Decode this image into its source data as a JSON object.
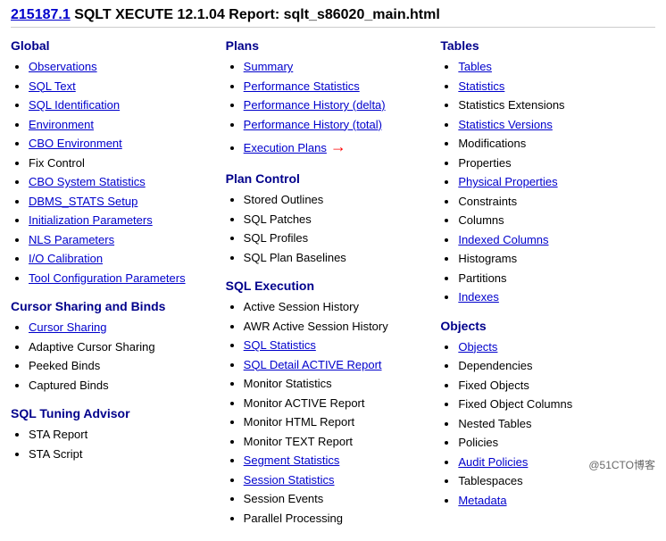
{
  "header": {
    "id": "215187.1",
    "title": "SQLT XECUTE 12.1.04  Report: sqlt_s86020_main.html"
  },
  "columns": {
    "global": {
      "title": "Global",
      "items": [
        {
          "label": "Observations",
          "link": true
        },
        {
          "label": "SQL Text",
          "link": true
        },
        {
          "label": "SQL Identification",
          "link": true
        },
        {
          "label": "Environment",
          "link": true
        },
        {
          "label": "CBO Environment",
          "link": true
        },
        {
          "label": "Fix Control",
          "link": false
        },
        {
          "label": "CBO System Statistics",
          "link": true
        },
        {
          "label": "DBMS_STATS Setup",
          "link": true
        },
        {
          "label": "Initialization Parameters",
          "link": true
        },
        {
          "label": "NLS Parameters",
          "link": true
        },
        {
          "label": "I/O Calibration",
          "link": true
        },
        {
          "label": "Tool Configuration Parameters",
          "link": true
        }
      ]
    },
    "cursor": {
      "title": "Cursor Sharing and Binds",
      "items": [
        {
          "label": "Cursor Sharing",
          "link": true
        },
        {
          "label": "Adaptive Cursor Sharing",
          "link": false
        },
        {
          "label": "Peeked Binds",
          "link": false
        },
        {
          "label": "Captured Binds",
          "link": false
        }
      ]
    },
    "sta": {
      "title": "SQL Tuning Advisor",
      "items": [
        {
          "label": "STA Report",
          "link": false
        },
        {
          "label": "STA Script",
          "link": false
        }
      ]
    },
    "plans": {
      "title": "Plans",
      "items": [
        {
          "label": "Summary",
          "link": true
        },
        {
          "label": "Performance Statistics",
          "link": true
        },
        {
          "label": "Performance History (delta)",
          "link": true
        },
        {
          "label": "Performance History (total)",
          "link": true
        },
        {
          "label": "Execution Plans",
          "link": true,
          "arrow": true
        }
      ]
    },
    "plan_control": {
      "title": "Plan Control",
      "items": [
        {
          "label": "Stored Outlines",
          "link": false
        },
        {
          "label": "SQL Patches",
          "link": false
        },
        {
          "label": "SQL Profiles",
          "link": false
        },
        {
          "label": "SQL Plan Baselines",
          "link": false
        }
      ]
    },
    "sql_execution": {
      "title": "SQL Execution",
      "items": [
        {
          "label": "Active Session History",
          "link": false
        },
        {
          "label": "AWR Active Session History",
          "link": false
        },
        {
          "label": "SQL Statistics",
          "link": true
        },
        {
          "label": "SQL Detail ACTIVE Report",
          "link": true
        },
        {
          "label": "Monitor Statistics",
          "link": false
        },
        {
          "label": "Monitor ACTIVE Report",
          "link": false
        },
        {
          "label": "Monitor HTML Report",
          "link": false
        },
        {
          "label": "Monitor TEXT Report",
          "link": false
        },
        {
          "label": "Segment Statistics",
          "link": true
        },
        {
          "label": "Session Statistics",
          "link": true
        },
        {
          "label": "Session Events",
          "link": false
        },
        {
          "label": "Parallel Processing",
          "link": false
        }
      ]
    },
    "tables": {
      "title": "Tables",
      "items": [
        {
          "label": "Tables",
          "link": true
        },
        {
          "label": "Statistics",
          "link": true
        },
        {
          "label": "Statistics Extensions",
          "link": false
        },
        {
          "label": "Statistics Versions",
          "link": true
        },
        {
          "label": "Modifications",
          "link": false
        },
        {
          "label": "Properties",
          "link": false
        },
        {
          "label": "Physical Properties",
          "link": true
        },
        {
          "label": "Constraints",
          "link": false
        },
        {
          "label": "Columns",
          "link": false
        },
        {
          "label": "Indexed Columns",
          "link": true
        },
        {
          "label": "Histograms",
          "link": false
        },
        {
          "label": "Partitions",
          "link": false
        },
        {
          "label": "Indexes",
          "link": true
        }
      ]
    },
    "objects": {
      "title": "Objects",
      "items": [
        {
          "label": "Objects",
          "link": true
        },
        {
          "label": "Dependencies",
          "link": false
        },
        {
          "label": "Fixed Objects",
          "link": false
        },
        {
          "label": "Fixed Object Columns",
          "link": false
        },
        {
          "label": "Nested Tables",
          "link": false
        },
        {
          "label": "Policies",
          "link": false
        },
        {
          "label": "Audit Policies",
          "link": true
        },
        {
          "label": "Tablespaces",
          "link": false
        },
        {
          "label": "Metadata",
          "link": true
        }
      ]
    }
  },
  "watermark": "@51CTO博客"
}
